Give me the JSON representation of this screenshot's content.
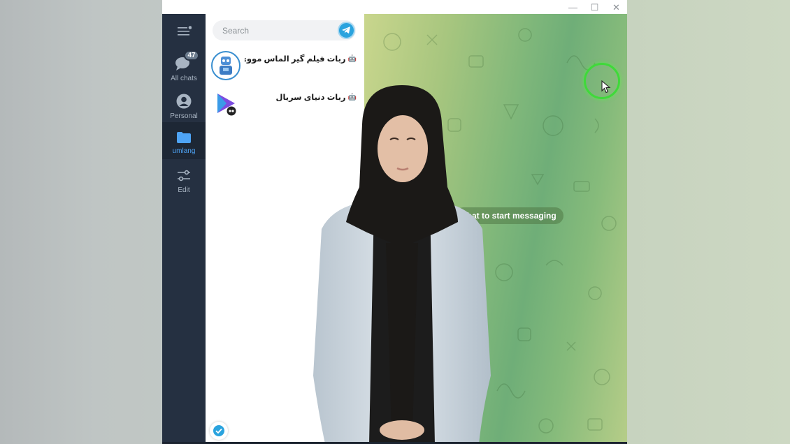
{
  "window": {
    "controls": {
      "minimize": "—",
      "maximize": "☐",
      "close": "✕"
    }
  },
  "sidebar": {
    "folders": [
      {
        "label": "All chats",
        "badge": "47",
        "icon": "chats-icon"
      },
      {
        "label": "Personal",
        "icon": "user-icon"
      },
      {
        "label": "umlang",
        "icon": "folder-icon",
        "active": true
      },
      {
        "label": "Edit",
        "icon": "sliders-icon"
      }
    ]
  },
  "chatlist": {
    "search": {
      "placeholder": "Search"
    },
    "chats": [
      {
        "name": "ربات فیلم گیر الماس مووی | ...",
        "bot": true
      },
      {
        "name": "ربات دنیای سریال",
        "bot": true
      }
    ]
  },
  "chat_pane": {
    "empty_message": "chat to start messaging"
  },
  "colors": {
    "sidebar_bg": "#253041",
    "active_folder": "#4ea4f6",
    "accent": "#2aa3de",
    "cursor_highlight": "#3fd93a"
  }
}
